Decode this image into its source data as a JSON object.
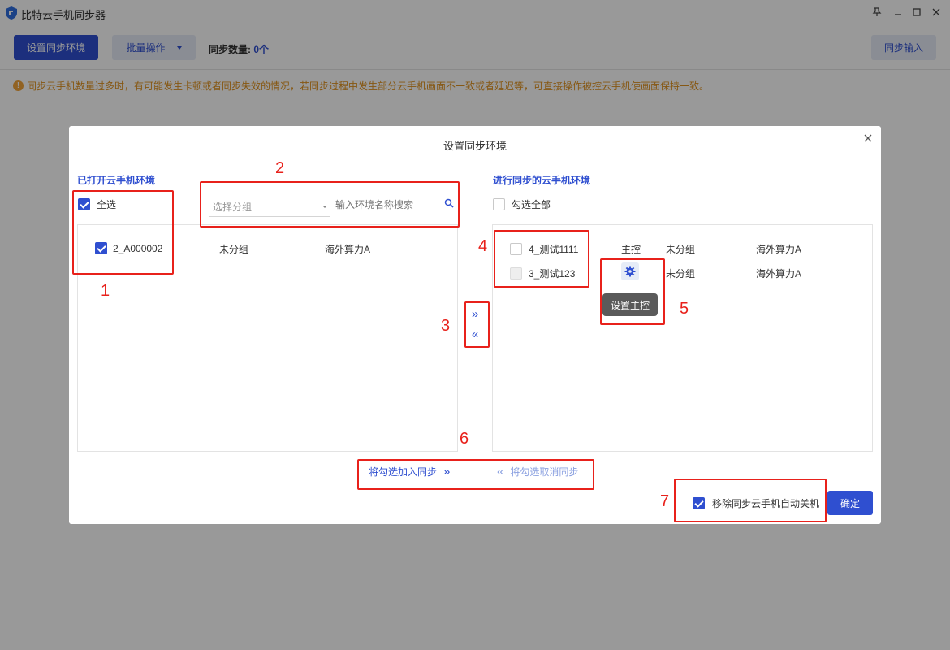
{
  "window": {
    "title": "比特云手机同步器"
  },
  "toolbar": {
    "setup_env_label": "设置同步环境",
    "batch_label": "批量操作",
    "sync_count_label": "同步数量:",
    "sync_count_value": "0个",
    "sync_input_label": "同步输入"
  },
  "notice": {
    "text": "同步云手机数量过多时，有可能发生卡顿或者同步失效的情况，若同步过程中发生部分云手机画面不一致或者延迟等，可直接操作被控云手机使画面保持一致。"
  },
  "modal": {
    "title": "设置同步环境",
    "left": {
      "title": "已打开云手机环境",
      "select_all_label": "全选",
      "group_select_placeholder": "选择分组",
      "search_placeholder": "输入环境名称搜索",
      "rows": [
        {
          "name": "2_A000002",
          "group": "未分组",
          "proxy": "海外算力A",
          "checked": true
        }
      ]
    },
    "right": {
      "title": "进行同步的云手机环境",
      "select_all_label": "勾选全部",
      "rows": [
        {
          "name": "4_测试1111",
          "role": "主控",
          "group": "未分组",
          "proxy": "海外算力A"
        },
        {
          "name": "3_测试123",
          "role": "",
          "group": "未分组",
          "proxy": "海外算力A"
        }
      ],
      "tooltip": "设置主控"
    },
    "add_checked_label": "将勾选加入同步",
    "remove_checked_label": "将勾选取消同步",
    "auto_shutdown_label": "移除同步云手机自动关机",
    "confirm_label": "确定"
  },
  "annotations": [
    "1",
    "2",
    "3",
    "4",
    "5",
    "6",
    "7"
  ],
  "colors": {
    "primary": "#2f4fd0",
    "warning": "#e0921e",
    "annotation": "#e8211b"
  }
}
